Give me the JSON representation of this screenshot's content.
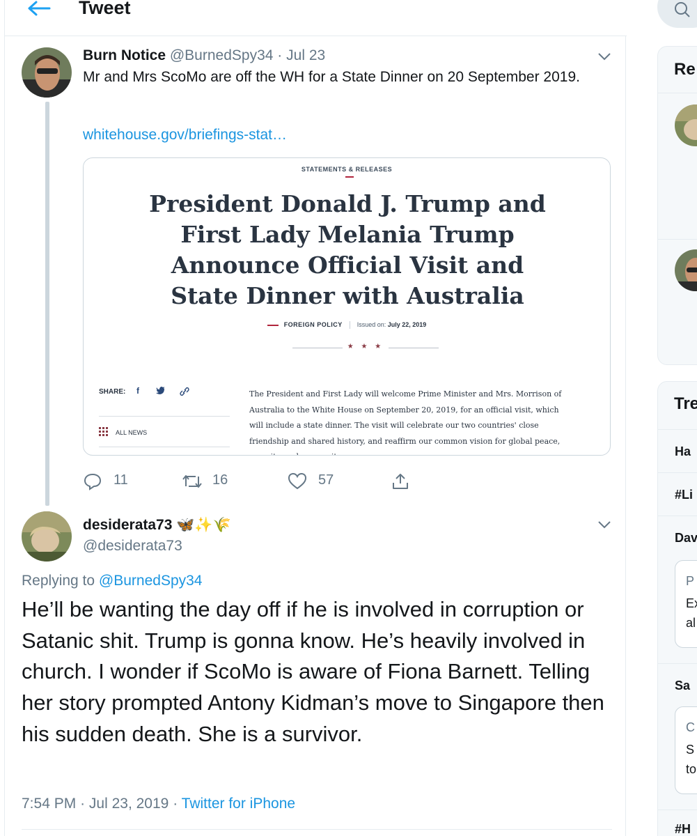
{
  "header": {
    "title": "Tweet"
  },
  "tweet1": {
    "name": "Burn Notice",
    "handle": "@BurnedSpy34",
    "separator": "·",
    "date": "Jul 23",
    "text": "Mr and Mrs ScoMo are off the WH for a State Dinner on 20 September 2019.",
    "link": "whitehouse.gov/briefings-stat…",
    "card": {
      "kicker": "STATEMENTS & RELEASES",
      "headline": "President Donald J. Trump and First Lady Melania Trump Announce Official Visit and State Dinner with Australia",
      "category": "FOREIGN POLICY",
      "issued_label": "Issued on:",
      "issued_date": "July 22, 2019",
      "stars": "★ ★ ★",
      "share_label": "SHARE:",
      "all_news": "ALL NEWS",
      "body": "The President and First Lady will welcome Prime Minister and Mrs. Morrison of Australia to the White House on September 20, 2019, for an official visit, which will include a state dinner. The visit will celebrate our two countries' close friendship and shared history, and reaffirm our common vision for global peace, security, and prosperity."
    },
    "actions": {
      "replies": "11",
      "retweets": "16",
      "likes": "57"
    }
  },
  "tweet2": {
    "name": "desiderata73",
    "emoji": "🦋✨🌾",
    "handle": "@desiderata73",
    "replying_prefix": "Replying to ",
    "replying_handle": "@BurnedSpy34",
    "text": "He’ll be wanting the day off if he is involved in corruption or Satanic shit. Trump is gonna know. He’s heavily involved in church. I wonder if ScoMo is aware of Fiona Barnett. Telling her story prompted Antony Kidman’s move to Singapore then his sudden death. She is a survivor.",
    "time": "7:54 PM",
    "date": "Jul 23, 2019",
    "separator": "·",
    "source": "Twitter for iPhone"
  },
  "sidebar": {
    "panel1_title": "Re",
    "panel2_title": "Tre",
    "trends": [
      "Ha",
      "#Li",
      "Dav",
      "Sa",
      "#H"
    ],
    "trend_card1": [
      "P",
      "Ex",
      "al"
    ],
    "trend_card2": [
      "C",
      "S",
      "to"
    ]
  },
  "colors": {
    "link": "#1b95e0",
    "muted": "#657786",
    "border": "#e6ecf0",
    "text": "#14171a"
  }
}
